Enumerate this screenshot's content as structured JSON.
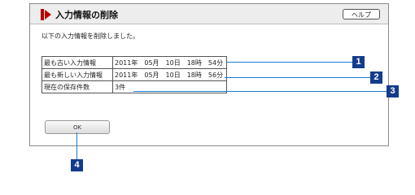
{
  "dialog": {
    "title": "入力情報の削除",
    "help_label": "ヘルプ",
    "message": "以下の入力情報を削除しました。",
    "rows": [
      {
        "label": "最も古い入力情報",
        "value": "2011年　05月　10日　18時　54分"
      },
      {
        "label": "最も新しい入力情報",
        "value": "2011年　05月　10日　18時　56分"
      },
      {
        "label": "現在の保存件数",
        "value": "3件"
      }
    ],
    "ok_label": "OK"
  },
  "callouts": [
    "1",
    "2",
    "3",
    "4"
  ],
  "colors": {
    "accent": "#c00000",
    "badge": "#133c8b",
    "callout_line": "#1a7bd8"
  }
}
